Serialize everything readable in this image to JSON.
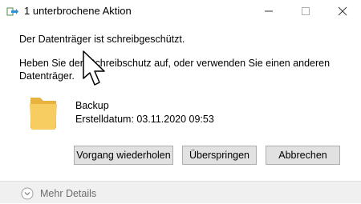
{
  "window": {
    "title": "1 unterbrochene Aktion",
    "title_icon": "file-transfer-icon",
    "controls": [
      "minimize-icon",
      "maximize-icon",
      "close-icon"
    ]
  },
  "message": {
    "line1": "Der Datenträger ist schreibgeschützt.",
    "line2": "Heben Sie den Schreibschutz auf, oder verwenden Sie einen anderen Datenträger."
  },
  "item": {
    "icon": "folder-icon",
    "name": "Backup",
    "date": "Erstelldatum: 03.11.2020 09:53"
  },
  "buttons": {
    "retry": "Vorgang wiederholen",
    "skip": "Überspringen",
    "cancel": "Abbrechen"
  },
  "footer": {
    "details_label": "Mehr Details",
    "details_icon": "chevron-down-circle-icon"
  },
  "colors": {
    "folder": "#f5c75c",
    "button_bg": "#e1e1e1",
    "footer_bg": "#f0f0f0"
  },
  "cursor": "arrow-pointer"
}
